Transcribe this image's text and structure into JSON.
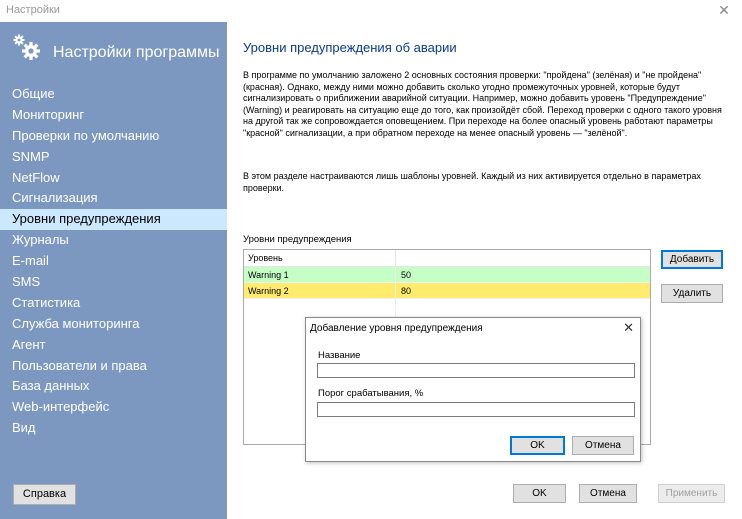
{
  "window": {
    "title": "Настройки"
  },
  "sidebar": {
    "header_title": "Настройки программы",
    "items": [
      {
        "label": "Общие"
      },
      {
        "label": "Мониторинг"
      },
      {
        "label": "Проверки по умолчанию"
      },
      {
        "label": "SNMP"
      },
      {
        "label": "NetFlow"
      },
      {
        "label": "Сигнализация"
      },
      {
        "label": "Уровни предупреждения",
        "active": true
      },
      {
        "label": "Журналы"
      },
      {
        "label": "E-mail"
      },
      {
        "label": "SMS"
      },
      {
        "label": "Статистика"
      },
      {
        "label": "Служба мониторинга"
      },
      {
        "label": "Агент"
      },
      {
        "label": "Пользователи и права"
      },
      {
        "label": "База данных"
      },
      {
        "label": "Web-интерфейс"
      },
      {
        "label": "Вид"
      }
    ],
    "help_label": "Справка"
  },
  "main": {
    "title": "Уровни предупреждения об аварии",
    "description": "В программе по умолчанию заложено 2 основных состояния проверки: \"пройдена\" (зелёная) и \"не пройдена\" (красная). Однако, между ними можно добавить сколько угодно промежуточных уровней, которые будут сигнализировать о приближении аварийной ситуации. Например, можно добавить уровень \"Предупреждение\" (Warning) и реагировать на ситуацию еще до того, как произойдёт сбой. Переход проверки с одного такого уровня на другой так же сопровождается оповещением. При переходе на более опасный уровень работают параметры \"красной\" сигнализации, а при обратном переходе на менее опасный уровень — \"зелёной\".",
    "description2": "В этом разделе настраиваются лишь шаблоны уровней. Каждый из них активируется отдельно в параметрах проверки.",
    "table_label": "Уровни предупреждения",
    "table": {
      "columns": [
        "Уровень",
        ""
      ],
      "rows": [
        {
          "level": "Warning 1",
          "threshold": "50",
          "color": "#c6ffc6"
        },
        {
          "level": "Warning 2",
          "threshold": "80",
          "color": "#ffec6f"
        }
      ]
    },
    "add_label": "Добавить",
    "delete_label": "Удалить",
    "ok_label": "OK",
    "cancel_label": "Отмена",
    "apply_label": "Применить"
  },
  "dialog": {
    "title": "Добавление уровня предупреждения",
    "name_label": "Название",
    "name_value": "",
    "threshold_label": "Порог срабатывания, %",
    "threshold_value": "",
    "ok_label": "OK",
    "cancel_label": "Отмена"
  },
  "colors": {
    "sidebar_bg": "#7d98c0",
    "active_item_bg": "#cce8ff",
    "title_blue": "#0a3a8c",
    "accent": "#0078d7"
  }
}
